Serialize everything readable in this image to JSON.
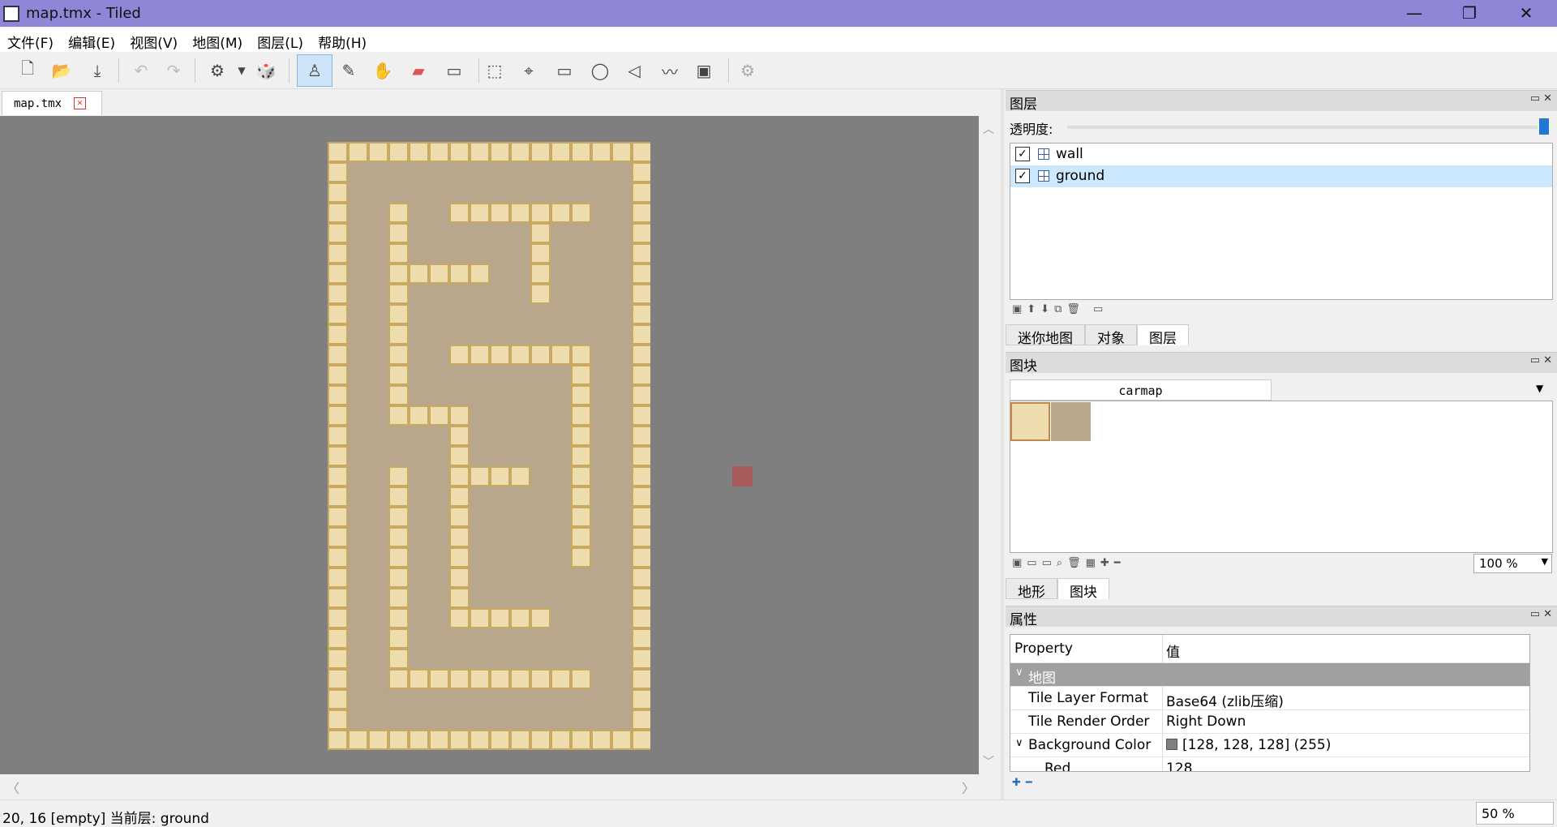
{
  "window": {
    "title": "map.tmx - Tiled"
  },
  "menu": [
    "文件(F)",
    "编辑(E)",
    "视图(V)",
    "地图(M)",
    "图层(L)",
    "帮助(H)"
  ],
  "document": {
    "tab_label": "map.tmx"
  },
  "layers_panel": {
    "title": "图层",
    "opacity_label": "透明度:",
    "layers": [
      {
        "name": "wall",
        "visible": true,
        "selected": false
      },
      {
        "name": "ground",
        "visible": true,
        "selected": true
      }
    ],
    "tabs": [
      "迷你地图",
      "对象",
      "图层"
    ],
    "active_tab": "图层"
  },
  "tileset_panel": {
    "title": "图块",
    "tileset_name": "carmap",
    "zoom": "100 %",
    "tabs": [
      "地形",
      "图块"
    ],
    "active_tab": "图块"
  },
  "properties_panel": {
    "title": "属性",
    "col_property": "Property",
    "col_value": "值",
    "rows": [
      {
        "type": "group",
        "key": "地图"
      },
      {
        "type": "row",
        "key": "Tile Layer Format",
        "value": "Base64 (zlib压缩)"
      },
      {
        "type": "row",
        "key": "Tile Render Order",
        "value": "Right Down"
      },
      {
        "type": "group-sub",
        "key": "Background Color",
        "value": "[128, 128, 128] (255)",
        "swatch": "#808080"
      },
      {
        "type": "row",
        "key": "Red",
        "value": "128",
        "indent": true
      }
    ]
  },
  "status": {
    "text": "20, 16 [empty] 当前层: ground",
    "zoom": "50 %"
  },
  "colors": {
    "titlebar": "#8e86d6",
    "canvas": "#7f7f7f",
    "ground": "#b8a68d",
    "wall": "#ecdcae",
    "selection": "#cce8ff"
  }
}
